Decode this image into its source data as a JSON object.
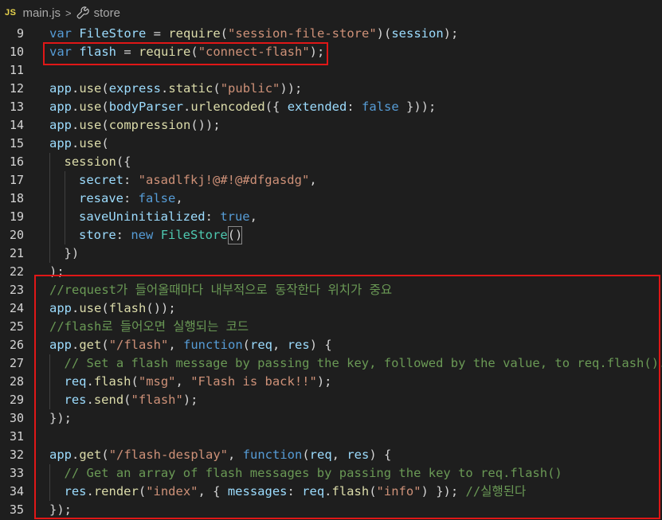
{
  "breadcrumb": {
    "badge": "JS",
    "file": "main.js",
    "separator": ">",
    "symbol": "store",
    "symbol_icon": "wrench-icon"
  },
  "editor": {
    "lines": [
      {
        "number": "9",
        "indent": 0,
        "tokens": [
          [
            "kw",
            "var"
          ],
          [
            "pn",
            " "
          ],
          [
            "vr",
            "FileStore"
          ],
          [
            "pn",
            " = "
          ],
          [
            "fn",
            "require"
          ],
          [
            "pn",
            "("
          ],
          [
            "str",
            "\"session-file-store\""
          ],
          [
            "pn",
            ")("
          ],
          [
            "vr",
            "session"
          ],
          [
            "pn",
            ");"
          ]
        ]
      },
      {
        "number": "10",
        "indent": 0,
        "tokens": [
          [
            "kw",
            "var"
          ],
          [
            "pn",
            " "
          ],
          [
            "vr",
            "flash"
          ],
          [
            "pn",
            " = "
          ],
          [
            "fn",
            "require"
          ],
          [
            "pn",
            "("
          ],
          [
            "str",
            "\"connect-flash\""
          ],
          [
            "pn",
            ");"
          ]
        ]
      },
      {
        "number": "11",
        "indent": 0,
        "tokens": []
      },
      {
        "number": "12",
        "indent": 0,
        "tokens": [
          [
            "vr",
            "app"
          ],
          [
            "pn",
            "."
          ],
          [
            "fn",
            "use"
          ],
          [
            "pn",
            "("
          ],
          [
            "vr",
            "express"
          ],
          [
            "pn",
            "."
          ],
          [
            "fn",
            "static"
          ],
          [
            "pn",
            "("
          ],
          [
            "str",
            "\"public\""
          ],
          [
            "pn",
            "));"
          ]
        ]
      },
      {
        "number": "13",
        "indent": 0,
        "tokens": [
          [
            "vr",
            "app"
          ],
          [
            "pn",
            "."
          ],
          [
            "fn",
            "use"
          ],
          [
            "pn",
            "("
          ],
          [
            "vr",
            "bodyParser"
          ],
          [
            "pn",
            "."
          ],
          [
            "fn",
            "urlencoded"
          ],
          [
            "pn",
            "({ "
          ],
          [
            "vr",
            "extended"
          ],
          [
            "pn",
            ": "
          ],
          [
            "kw",
            "false"
          ],
          [
            "pn",
            " }));"
          ]
        ]
      },
      {
        "number": "14",
        "indent": 0,
        "tokens": [
          [
            "vr",
            "app"
          ],
          [
            "pn",
            "."
          ],
          [
            "fn",
            "use"
          ],
          [
            "pn",
            "("
          ],
          [
            "fn",
            "compression"
          ],
          [
            "pn",
            "());"
          ]
        ]
      },
      {
        "number": "15",
        "indent": 0,
        "tokens": [
          [
            "vr",
            "app"
          ],
          [
            "pn",
            "."
          ],
          [
            "fn",
            "use"
          ],
          [
            "pn",
            "("
          ]
        ]
      },
      {
        "number": "16",
        "indent": 1,
        "tokens": [
          [
            "fn",
            "session"
          ],
          [
            "pn",
            "({"
          ]
        ]
      },
      {
        "number": "17",
        "indent": 2,
        "tokens": [
          [
            "vr",
            "secret"
          ],
          [
            "pn",
            ": "
          ],
          [
            "str",
            "\"asadlfkj!@#!@#dfgasdg\""
          ],
          [
            "pn",
            ","
          ]
        ]
      },
      {
        "number": "18",
        "indent": 2,
        "tokens": [
          [
            "vr",
            "resave"
          ],
          [
            "pn",
            ": "
          ],
          [
            "kw",
            "false"
          ],
          [
            "pn",
            ","
          ]
        ]
      },
      {
        "number": "19",
        "indent": 2,
        "tokens": [
          [
            "vr",
            "saveUninitialized"
          ],
          [
            "pn",
            ": "
          ],
          [
            "kw",
            "true"
          ],
          [
            "pn",
            ","
          ]
        ]
      },
      {
        "number": "20",
        "indent": 2,
        "tokens": [
          [
            "vr",
            "store"
          ],
          [
            "pn",
            ": "
          ],
          [
            "kw",
            "new"
          ],
          [
            "pn",
            " "
          ],
          [
            "cls",
            "FileStore"
          ],
          [
            "bm",
            "()"
          ]
        ]
      },
      {
        "number": "21",
        "indent": 1,
        "tokens": [
          [
            "pn",
            "})"
          ]
        ]
      },
      {
        "number": "22",
        "indent": 0,
        "tokens": [
          [
            "pn",
            ");"
          ]
        ]
      },
      {
        "number": "23",
        "indent": 0,
        "tokens": [
          [
            "cm",
            "//request가 들어올때마다 내부적으로 동작한다 위치가 중요"
          ]
        ]
      },
      {
        "number": "24",
        "indent": 0,
        "tokens": [
          [
            "vr",
            "app"
          ],
          [
            "pn",
            "."
          ],
          [
            "fn",
            "use"
          ],
          [
            "pn",
            "("
          ],
          [
            "fn",
            "flash"
          ],
          [
            "pn",
            "());"
          ]
        ]
      },
      {
        "number": "25",
        "indent": 0,
        "tokens": [
          [
            "cm",
            "//flash로 들어오면 실행되는 코드"
          ]
        ]
      },
      {
        "number": "26",
        "indent": 0,
        "tokens": [
          [
            "vr",
            "app"
          ],
          [
            "pn",
            "."
          ],
          [
            "fn",
            "get"
          ],
          [
            "pn",
            "("
          ],
          [
            "str",
            "\"/flash\""
          ],
          [
            "pn",
            ", "
          ],
          [
            "kw",
            "function"
          ],
          [
            "pn",
            "("
          ],
          [
            "vr",
            "req"
          ],
          [
            "pn",
            ", "
          ],
          [
            "vr",
            "res"
          ],
          [
            "pn",
            ") {"
          ]
        ]
      },
      {
        "number": "27",
        "indent": 1,
        "tokens": [
          [
            "cm",
            "// Set a flash message by passing the key, followed by the value, to req.flash()."
          ]
        ]
      },
      {
        "number": "28",
        "indent": 1,
        "tokens": [
          [
            "vr",
            "req"
          ],
          [
            "pn",
            "."
          ],
          [
            "fn",
            "flash"
          ],
          [
            "pn",
            "("
          ],
          [
            "str",
            "\"msg\""
          ],
          [
            "pn",
            ", "
          ],
          [
            "str",
            "\"Flash is back!!\""
          ],
          [
            "pn",
            ");"
          ]
        ]
      },
      {
        "number": "29",
        "indent": 1,
        "tokens": [
          [
            "vr",
            "res"
          ],
          [
            "pn",
            "."
          ],
          [
            "fn",
            "send"
          ],
          [
            "pn",
            "("
          ],
          [
            "str",
            "\"flash\""
          ],
          [
            "pn",
            ");"
          ]
        ]
      },
      {
        "number": "30",
        "indent": 0,
        "tokens": [
          [
            "pn",
            "});"
          ]
        ]
      },
      {
        "number": "31",
        "indent": 0,
        "tokens": []
      },
      {
        "number": "32",
        "indent": 0,
        "tokens": [
          [
            "vr",
            "app"
          ],
          [
            "pn",
            "."
          ],
          [
            "fn",
            "get"
          ],
          [
            "pn",
            "("
          ],
          [
            "str",
            "\"/flash-desplay\""
          ],
          [
            "pn",
            ", "
          ],
          [
            "kw",
            "function"
          ],
          [
            "pn",
            "("
          ],
          [
            "vr",
            "req"
          ],
          [
            "pn",
            ", "
          ],
          [
            "vr",
            "res"
          ],
          [
            "pn",
            ") {"
          ]
        ]
      },
      {
        "number": "33",
        "indent": 1,
        "tokens": [
          [
            "cm",
            "// Get an array of flash messages by passing the key to req.flash()"
          ]
        ]
      },
      {
        "number": "34",
        "indent": 1,
        "tokens": [
          [
            "vr",
            "res"
          ],
          [
            "pn",
            "."
          ],
          [
            "fn",
            "render"
          ],
          [
            "pn",
            "("
          ],
          [
            "str",
            "\"index\""
          ],
          [
            "pn",
            ", { "
          ],
          [
            "vr",
            "messages"
          ],
          [
            "pn",
            ": "
          ],
          [
            "vr",
            "req"
          ],
          [
            "pn",
            "."
          ],
          [
            "fn",
            "flash"
          ],
          [
            "pn",
            "("
          ],
          [
            "str",
            "\"info\""
          ],
          [
            "pn",
            ") }); "
          ],
          [
            "cm",
            "//실행된다"
          ]
        ]
      },
      {
        "number": "35",
        "indent": 0,
        "tokens": [
          [
            "pn",
            "});"
          ]
        ]
      }
    ]
  },
  "highlight_color": "#e01717"
}
